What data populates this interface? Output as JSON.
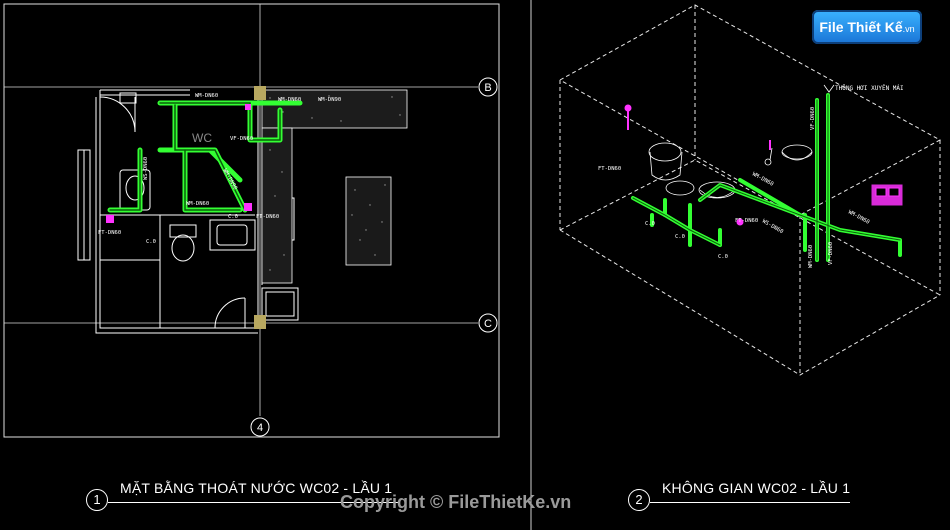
{
  "grid_labels": {
    "b": "B",
    "c": "C",
    "four": "4"
  },
  "room_label": "WC",
  "plan": {
    "pipes": [
      "WM-DN60",
      "WM-DN60",
      "WM-DN90",
      "WM-DN90",
      "WM-DN60",
      "WS-DN60",
      "VF-DN60",
      "FT-DN60",
      "FT-DN60"
    ],
    "elevations": [
      "C.0",
      "C.0"
    ]
  },
  "iso": {
    "pipe_labels": [
      "FT-DN60",
      "FT-DN60",
      "WS-DN60",
      "WM-DN60",
      "VF-DN60",
      "WM-DN60",
      "WM-DN60",
      "VF-DN60"
    ],
    "elevations": [
      "C.0",
      "C.0",
      "C.0"
    ],
    "vent_note": "THÔNG HƠI XUYÊN MÁI"
  },
  "views": [
    {
      "number": "1",
      "title": "MẶT BẰNG THOÁT NƯỚC WC02 - LẦU 1"
    },
    {
      "number": "2",
      "title": "KHÔNG GIAN WC02 - LẦU 1"
    }
  ],
  "copyright": "Copyright © FileThietKe.vn",
  "logo": {
    "text": "File Thiết Kế",
    "suffix": ".vn"
  },
  "colors": {
    "background": "#000000",
    "pipe": "#33ff33",
    "fixture": "#ff33ff",
    "wall": "#ffffff",
    "grid": "#d8d8d8"
  }
}
